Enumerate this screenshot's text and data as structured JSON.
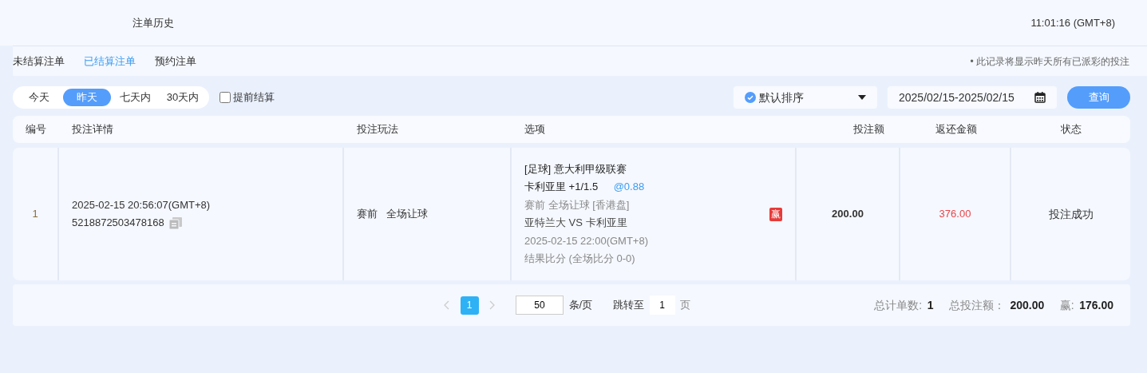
{
  "header": {
    "title": "注单历史",
    "clock": "11:01:16 (GMT+8)"
  },
  "tabs": [
    {
      "label": "未结算注单",
      "selected": false
    },
    {
      "label": "已结算注单",
      "selected": true
    },
    {
      "label": "预约注单",
      "selected": false
    }
  ],
  "notice": "• 此记录将显示昨天所有已派彩的投注",
  "periods": [
    {
      "label": "今天",
      "selected": false
    },
    {
      "label": "昨天",
      "selected": true
    },
    {
      "label": "七天内",
      "selected": false
    },
    {
      "label": "30天内",
      "selected": false
    }
  ],
  "early_settle": {
    "label": "提前结算",
    "checked": false
  },
  "sort": {
    "value": "默认排序"
  },
  "date_range": {
    "value": "2025/02/15-2025/02/15"
  },
  "query_button": "查询",
  "table": {
    "columns": [
      "编号",
      "投注详情",
      "投注玩法",
      "选项",
      "投注额",
      "返还金额",
      "状态"
    ],
    "rows": [
      {
        "index": "1",
        "time": "2025-02-15 20:56:07(GMT+8)",
        "bet_id": "5218872503478168",
        "play": "赛前   全场让球",
        "league": "[足球] 意大利甲级联赛",
        "pick": "卡利亚里 +1/1.5",
        "odds": "@0.88",
        "market": "赛前  全场让球 [香港盘]",
        "match": "亚特兰大 VS 卡利亚里",
        "kickoff": "2025-02-15 22:00(GMT+8)",
        "result": "结果比分 (全场比分 0-0)",
        "outcome_tag": "赢",
        "stake": "200.00",
        "returned": "376.00",
        "status": "投注成功"
      }
    ]
  },
  "pagination": {
    "pages": [
      {
        "label": "1",
        "selected": true
      }
    ],
    "page_size": "50",
    "page_size_unit": "条/页",
    "jump_label": "跳转至",
    "jump_value": "1",
    "jump_unit": "页"
  },
  "summary": [
    {
      "label": "总计单数:",
      "value": "1"
    },
    {
      "label": "总投注额：",
      "value": "200.00"
    },
    {
      "label": "赢:",
      "value": "176.00"
    }
  ]
}
